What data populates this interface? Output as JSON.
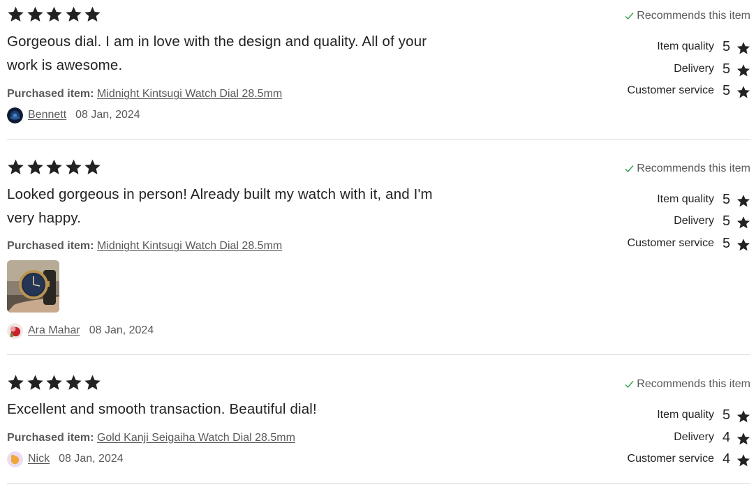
{
  "colors": {
    "star": "#222222",
    "check": "#2e9e4f",
    "muted": "#595959",
    "divider": "#dcdcdc"
  },
  "reviews": [
    {
      "stars": 5,
      "text": "Gorgeous dial. I am in love with the design and quality. All of your\nwork is awesome.",
      "purchased_label": "Purchased item:",
      "item_name": "Midnight Kintsugi Watch Dial 28.5mm",
      "reviewer": "Bennett",
      "date": "08 Jan, 2024",
      "recommends": "Recommends this item",
      "ratings": [
        {
          "label": "Item quality",
          "value": "5"
        },
        {
          "label": "Delivery",
          "value": "5"
        },
        {
          "label": "Customer service",
          "value": "5"
        }
      ]
    },
    {
      "stars": 5,
      "text": "Looked gorgeous in person! Already built my watch with it, and I'm\nvery happy.",
      "purchased_label": "Purchased item:",
      "item_name": "Midnight Kintsugi Watch Dial 28.5mm",
      "reviewer": "Ara Mahar",
      "date": "08 Jan, 2024",
      "recommends": "Recommends this item",
      "ratings": [
        {
          "label": "Item quality",
          "value": "5"
        },
        {
          "label": "Delivery",
          "value": "5"
        },
        {
          "label": "Customer service",
          "value": "5"
        }
      ]
    },
    {
      "stars": 5,
      "text": "Excellent and smooth transaction. Beautiful dial!",
      "purchased_label": "Purchased item:",
      "item_name": "Gold Kanji Seigaiha Watch Dial 28.5mm",
      "reviewer": "Nick",
      "date": "08 Jan, 2024",
      "recommends": "Recommends this item",
      "ratings": [
        {
          "label": "Item quality",
          "value": "5"
        },
        {
          "label": "Delivery",
          "value": "4"
        },
        {
          "label": "Customer service",
          "value": "4"
        }
      ]
    }
  ]
}
